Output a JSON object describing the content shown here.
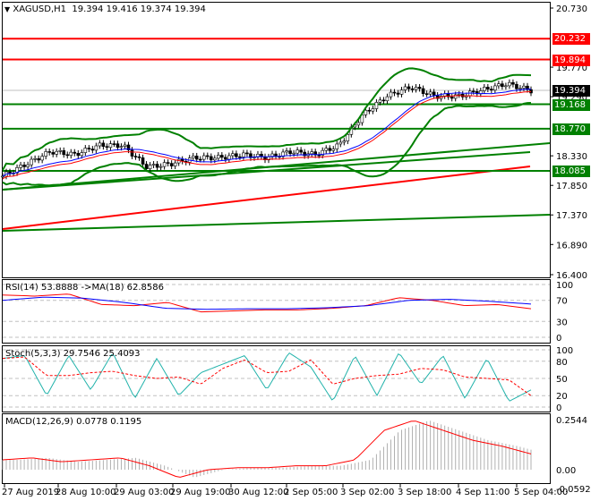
{
  "header": {
    "arrow": "▼",
    "symbol": "XAGUSD,H1",
    "ohlc": "19.394 19.416 19.374 19.394"
  },
  "price_axis": [
    "20.730",
    "19.770",
    "19.290",
    "18.330",
    "17.850",
    "17.370",
    "16.890",
    "16.400"
  ],
  "levels": [
    {
      "value": 20.232,
      "label": "20.232",
      "color": "#ff0000"
    },
    {
      "value": 19.894,
      "label": "19.894",
      "color": "#ff0000"
    },
    {
      "value": 19.168,
      "label": "19.168",
      "color": "#008000"
    },
    {
      "value": 18.77,
      "label": "18.770",
      "color": "#008000"
    },
    {
      "value": 18.085,
      "label": "18.085",
      "color": "#008000"
    }
  ],
  "current": {
    "value": 19.394,
    "label": "19.394",
    "color": "#000000"
  },
  "rsi": {
    "title": "RSI(14) 53.8888  ->MA(18) 62.8586",
    "axis": [
      "100",
      "70",
      "30",
      "0"
    ]
  },
  "stoch": {
    "title": "Stoch(5,3,3) 29.7546 25.4093",
    "axis": [
      "100",
      "80",
      "50",
      "20",
      "0"
    ]
  },
  "macd": {
    "title": "MACD(12,26,9) 0.0778 0.1195",
    "axis": [
      "0.2544",
      "0.00",
      "-0.0592"
    ]
  },
  "time_axis": [
    "27 Aug 2019",
    "28 Aug 10:00",
    "29 Aug 03:00",
    "29 Aug 19:00",
    "30 Aug 12:00",
    "2 Sep 05:00",
    "3 Sep 02:00",
    "3 Sep 18:00",
    "4 Sep 11:00",
    "5 Sep 04:00"
  ],
  "chart_data": {
    "type": "line",
    "title": "XAGUSD,H1",
    "ylim": [
      16.4,
      20.73
    ],
    "close_anchors": [
      18.0,
      18.2,
      18.4,
      18.35,
      18.5,
      18.5,
      18.15,
      18.2,
      18.3,
      18.3,
      18.35,
      18.3,
      18.4,
      18.35,
      18.5,
      19.0,
      19.3,
      19.45,
      19.3,
      19.3,
      19.4,
      19.5,
      19.39
    ],
    "rsi_anchors": [
      80,
      78,
      82,
      62,
      60,
      66,
      48,
      50,
      52,
      52,
      55,
      60,
      75,
      70,
      60,
      62,
      54
    ],
    "rsi_ma_anchors": [
      70,
      76,
      74,
      66,
      55,
      53,
      54,
      54,
      56,
      60,
      70,
      72,
      68,
      63
    ],
    "stoch_anchors": [
      85,
      90,
      20,
      90,
      30,
      95,
      15,
      85,
      20,
      60,
      75,
      90,
      30,
      95,
      70,
      10,
      90,
      20,
      95,
      40,
      90,
      15,
      85,
      10,
      30
    ],
    "macd_anchors": [
      0.05,
      0.06,
      0.04,
      0.05,
      0.06,
      0.02,
      -0.04,
      0.0,
      0.01,
      0.01,
      0.02,
      0.02,
      0.05,
      0.2,
      0.25,
      0.2,
      0.15,
      0.12,
      0.08
    ]
  }
}
